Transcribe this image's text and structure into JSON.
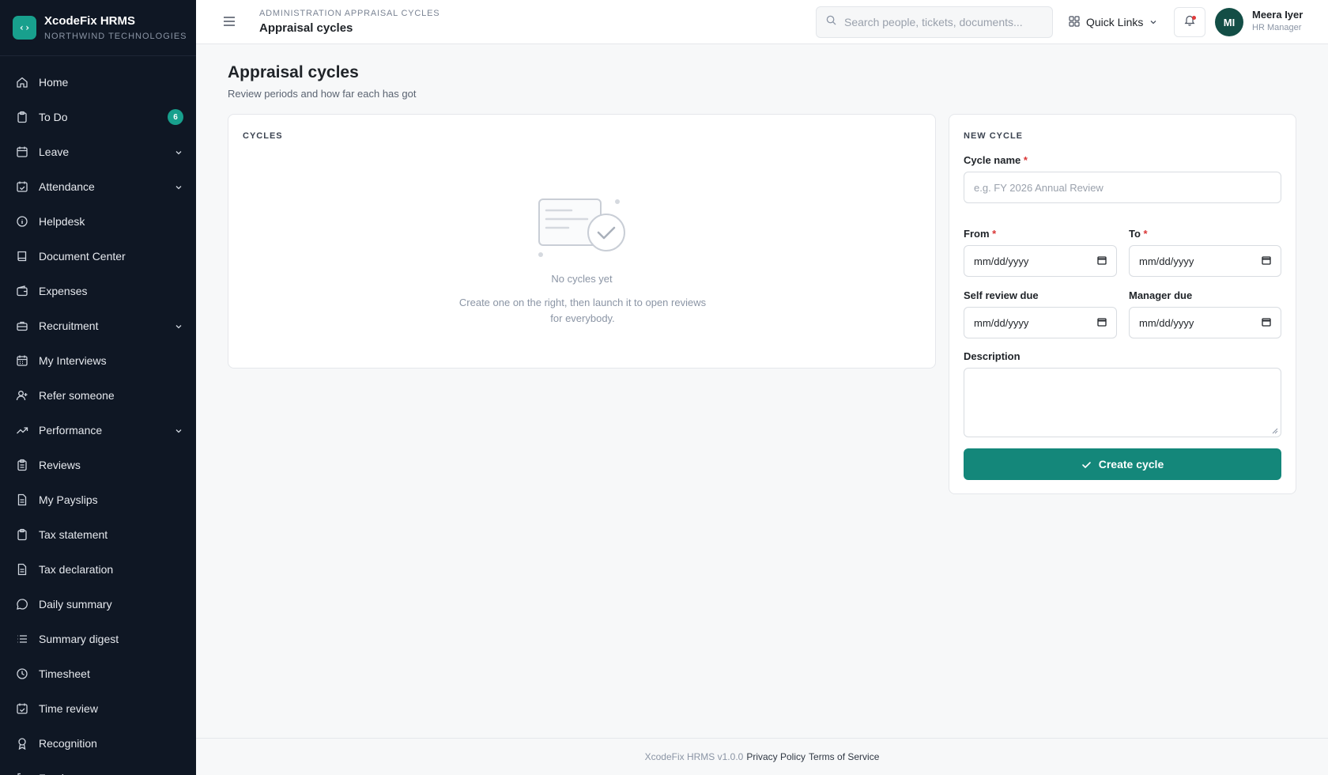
{
  "brand": {
    "name": "XcodeFix HRMS",
    "org": "NORTHWIND TECHNOLOGIES",
    "logo_glyph": "‹›"
  },
  "sidebar": {
    "items": [
      {
        "label": "Home",
        "icon": "home-icon"
      },
      {
        "label": "To Do",
        "icon": "clipboard-icon",
        "badge": "6"
      },
      {
        "label": "Leave",
        "icon": "calendar-icon",
        "expandable": true
      },
      {
        "label": "Attendance",
        "icon": "calendar-check-icon",
        "expandable": true
      },
      {
        "label": "Helpdesk",
        "icon": "info-icon"
      },
      {
        "label": "Document Center",
        "icon": "book-icon"
      },
      {
        "label": "Expenses",
        "icon": "wallet-icon"
      },
      {
        "label": "Recruitment",
        "icon": "briefcase-icon",
        "expandable": true
      },
      {
        "label": "My Interviews",
        "icon": "calendar-grid-icon"
      },
      {
        "label": "Refer someone",
        "icon": "user-plus-icon"
      },
      {
        "label": "Performance",
        "icon": "trending-up-icon",
        "expandable": true
      },
      {
        "label": "Reviews",
        "icon": "clipboard-list-icon"
      },
      {
        "label": "My Payslips",
        "icon": "file-text-icon"
      },
      {
        "label": "Tax statement",
        "icon": "clipboard-icon"
      },
      {
        "label": "Tax declaration",
        "icon": "file-text-icon"
      },
      {
        "label": "Daily summary",
        "icon": "message-circle-icon"
      },
      {
        "label": "Summary digest",
        "icon": "list-icon"
      },
      {
        "label": "Timesheet",
        "icon": "clock-icon"
      },
      {
        "label": "Time review",
        "icon": "calendar-check-icon"
      },
      {
        "label": "Recognition",
        "icon": "award-icon"
      },
      {
        "label": "Feeds",
        "icon": "log-out-icon"
      }
    ]
  },
  "topbar": {
    "breadcrumb": "ADMINISTRATION APPRAISAL CYCLES",
    "title": "Appraisal cycles",
    "search_placeholder": "Search people, tickets, documents...",
    "quick_links": "Quick Links",
    "user": {
      "initials": "MI",
      "name": "Meera Iyer",
      "role": "HR Manager"
    }
  },
  "main": {
    "heading": "Appraisal cycles",
    "subheading": "Review periods and how far each has got",
    "cycles": {
      "title": "CYCLES",
      "empty_title": "No cycles yet",
      "empty_desc": "Create one on the right, then launch it to open reviews for everybody."
    },
    "new_cycle": {
      "title": "NEW CYCLE",
      "name_label": "Cycle name",
      "name_placeholder": "e.g. FY 2026 Annual Review",
      "from_label": "From",
      "to_label": "To",
      "self_due_label": "Self review due",
      "manager_due_label": "Manager due",
      "date_placeholder": "mm/dd/yyyy",
      "description_label": "Description",
      "required_mark": "*",
      "create_label": "Create cycle"
    }
  },
  "footer": {
    "version": "XcodeFix HRMS v1.0.0",
    "privacy": "Privacy Policy",
    "terms": "Terms of Service"
  },
  "colors": {
    "sidebar_bg": "#0f1724",
    "accent": "#14877a",
    "badge": "#18a08d",
    "required": "#d93636"
  }
}
